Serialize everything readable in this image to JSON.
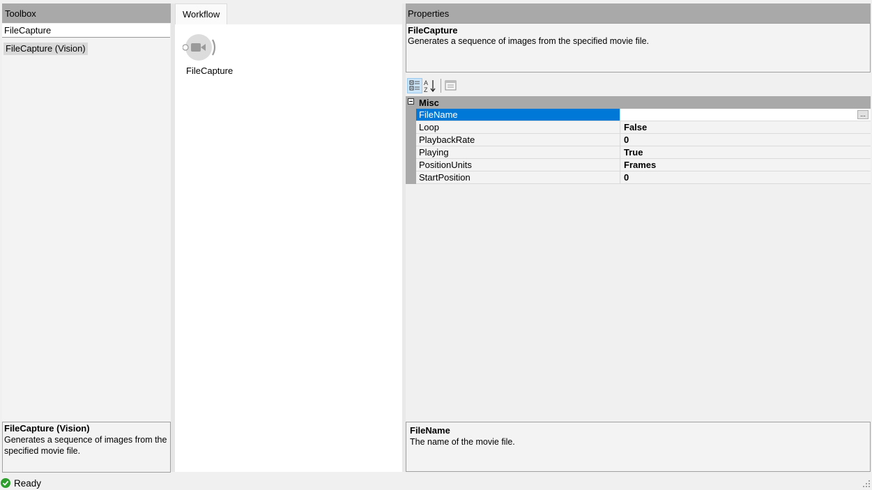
{
  "toolbox": {
    "title": "Toolbox",
    "search_value": "FileCapture",
    "results": [
      "FileCapture (Vision)"
    ],
    "description": {
      "title": "FileCapture (Vision)",
      "text": "Generates a sequence of images from the specified movie file."
    }
  },
  "workflow": {
    "tab_label": "Workflow",
    "node": {
      "label": "FileCapture",
      "icon": "camera-icon"
    }
  },
  "properties": {
    "title": "Properties",
    "object": {
      "name": "FileCapture",
      "description": "Generates a sequence of images from the specified movie file."
    },
    "toolbar": {
      "categorized_icon": "categorized-icon",
      "alphabetical_icon": "alphabetical-sort-icon",
      "pages_icon": "property-pages-icon"
    },
    "category": "Misc",
    "rows": [
      {
        "name": "FileName",
        "value": "",
        "selected": true
      },
      {
        "name": "Loop",
        "value": "False"
      },
      {
        "name": "PlaybackRate",
        "value": "0"
      },
      {
        "name": "Playing",
        "value": "True"
      },
      {
        "name": "PositionUnits",
        "value": "Frames"
      },
      {
        "name": "StartPosition",
        "value": "0"
      }
    ],
    "ellipsis_label": "...",
    "help": {
      "title": "FileName",
      "text": "The name of the movie file."
    }
  },
  "status": {
    "text": "Ready",
    "icon": "check-circle-icon",
    "color": "#2e9e2e"
  },
  "colors": {
    "header": "#a9a9a9",
    "selection": "#0078d7",
    "toolbar_active": "#cce4f7"
  }
}
